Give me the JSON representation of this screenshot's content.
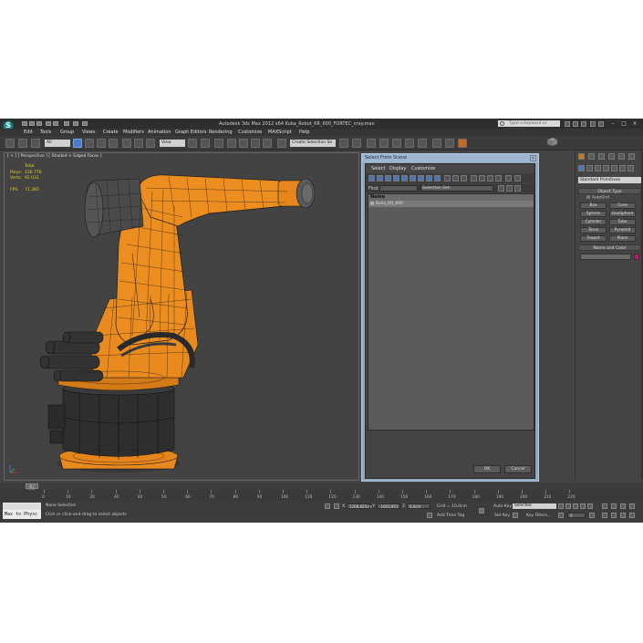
{
  "window": {
    "title": "Autodesk 3ds Max 2012 x64    Kuka_Robot_KR_600_FORTEC_vray.max",
    "search_placeholder": "Type a keyword or phrase",
    "controls": [
      "–",
      "□",
      "×"
    ]
  },
  "menu": [
    "Edit",
    "Tools",
    "Group",
    "Views",
    "Create",
    "Modifiers",
    "Animation",
    "Graph Editors",
    "Rendering",
    "Customize",
    "MAXScript",
    "Help"
  ],
  "toolbar": {
    "filter_value": "All",
    "coord_value": "View",
    "named_selection": "Create Selection Se"
  },
  "viewport": {
    "label": "[ + ] [ Perspective ] [ Shaded + Edged Faces ]",
    "stats": {
      "total_label": "Total",
      "polys_label": "Polys:",
      "polys_value": "156 776",
      "verts_label": "Verts:",
      "verts_value": "92 031",
      "fps_label": "FPS:",
      "fps_value": "71.385"
    }
  },
  "dialog": {
    "title": "Select From Scene",
    "close": "×",
    "menu": [
      "Select",
      "Display",
      "Customize"
    ],
    "find_label": "Find:",
    "selection_set_label": "Selection Set:",
    "column_name": "Name",
    "rows": [
      "Kuka_KR_600"
    ],
    "ok_label": "OK",
    "cancel_label": "Cancel"
  },
  "command_panel": {
    "dropdown": "Standard Primitives",
    "object_type_header": "Object Type",
    "autogrid_label": "AutoGrid",
    "buttons": [
      [
        "Box",
        "Cone"
      ],
      [
        "Sphere",
        "GeoSphere"
      ],
      [
        "Cylinder",
        "Tube"
      ],
      [
        "Torus",
        "Pyramid"
      ],
      [
        "Teapot",
        "Plane"
      ]
    ],
    "name_color_header": "Name and Color",
    "color": "#c0167a"
  },
  "timeline": {
    "slider_label": "0 / 225",
    "ticks": [
      "0",
      "10",
      "20",
      "30",
      "40",
      "50",
      "60",
      "70",
      "80",
      "90",
      "100",
      "110",
      "120",
      "130",
      "140",
      "150",
      "160",
      "170",
      "180",
      "190",
      "200",
      "210",
      "220"
    ]
  },
  "status": {
    "maxscript": "Max to Physc",
    "none_selected": "None Selected",
    "prompt": "Click or click-and-drag to select objects",
    "x_label": "X:",
    "x_value": "1208,825cm",
    "y_label": "Y:",
    "y_value": "-1003,951",
    "z_label": "Z:",
    "z_value": "0,0cm",
    "grid": "Grid = 10,0cm",
    "add_time_tag": "Add Time Tag",
    "auto_key": "Auto Key",
    "selected": "Selected",
    "set_key": "Set Key",
    "key_filters": "Key Filters...",
    "frame": "0"
  },
  "colors": {
    "robot_orange": "#e88a1e",
    "stats_yellow": "#e6d21a",
    "dialog_frame": "#8fa8c4"
  }
}
